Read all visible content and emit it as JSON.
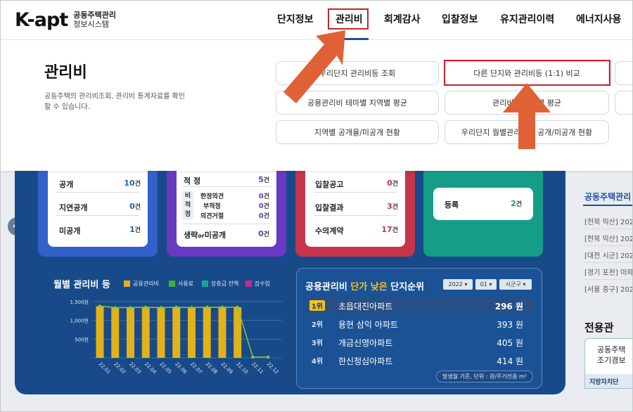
{
  "brand": {
    "logo": "K-apt",
    "sub_line1": "공동주택관리",
    "sub_line2": "정보시스템"
  },
  "nav": [
    "단지정보",
    "관리비",
    "회계감사",
    "입찰정보",
    "유지관리이력",
    "에너지사용"
  ],
  "mega": {
    "title": "관리비",
    "desc": "공동주택의 관리비조회, 관리비 통계자료를 확인 할 수 있습니다.",
    "menu": {
      "m1": "우리단지 관리비등 조회",
      "m2": "다른 단지와 관리비등 (1:1) 비교",
      "m3": "공용관리비 테마별 지역별 평균",
      "m4": "관리비등 지역별 평균",
      "m5": "지역별 공개율/미공개 현황",
      "m6": "우리단지 월별관리비등 공개/미공개 현황"
    }
  },
  "cards": {
    "c1": {
      "r1_label": "공개",
      "r1_val": "10",
      "r2_label": "지연공개",
      "r2_val": "0",
      "r3_label": "미공개",
      "r3_val": "1",
      "unit": "건"
    },
    "c2": {
      "top_label": "적 정",
      "top_val": "5",
      "side_label": "비적정",
      "s1_label": "한정의견",
      "s1_val": "0",
      "s2_label": "부적정",
      "s2_val": "0",
      "s3_label": "의견거절",
      "s3_val": "0",
      "bottom_label_a": "생략",
      "bottom_label_or": "or",
      "bottom_label_b": "미공개",
      "bottom_val": "0",
      "unit": "건"
    },
    "c3": {
      "r1_label": "입찰공고",
      "r1_val": "0",
      "r2_label": "입찰결과",
      "r2_val": "3",
      "r3_label": "수의계약",
      "r3_val": "17",
      "unit": "건"
    },
    "c4": {
      "label": "등록",
      "val": "2",
      "unit": "건"
    }
  },
  "chart_data": {
    "type": "bar",
    "title": "월별 관리비 등",
    "categories": [
      "22.01",
      "22.02",
      "22.03",
      "22.04",
      "22.05",
      "22.06",
      "22.07",
      "22.08",
      "22.09",
      "22.10",
      "22.11",
      "22.12"
    ],
    "series": [
      {
        "name": "공용관리비",
        "type": "bar",
        "values": [
          1380,
          1340,
          1340,
          1350,
          1340,
          1350,
          1340,
          1350,
          1350,
          1350,
          0,
          0
        ]
      },
      {
        "name": "사용료",
        "type": "line",
        "values": [
          1380,
          1340,
          1340,
          1350,
          1340,
          1350,
          1340,
          1350,
          1350,
          1350,
          20,
          20
        ]
      },
      {
        "name": "장충금 잔액",
        "values": []
      },
      {
        "name": "잡수입",
        "values": []
      }
    ],
    "yticks": [
      "1,500원",
      "1,000원",
      "500원"
    ],
    "ylim": [
      0,
      1500
    ],
    "colors": {
      "bar": "#e2b21a",
      "line": "#86c93a",
      "legend3": "#18a79a",
      "legend4": "#c42d91"
    }
  },
  "ranking": {
    "title_a": "공용관리비",
    "title_hl": "단가 낮은",
    "title_b": "단지순위",
    "sel_year": "2022",
    "sel_month": "01",
    "sel_region": "시군구",
    "rows": [
      {
        "rank": "1위",
        "name": "초읍대진아파트",
        "price": "296 원"
      },
      {
        "rank": "2위",
        "name": "용현 삼익 아파트",
        "price": "393 원"
      },
      {
        "rank": "3위",
        "name": "개금신영아파트",
        "price": "405 원"
      },
      {
        "rank": "4위",
        "name": "한신청심아파트",
        "price": "414 원"
      }
    ],
    "footnote": "발생월 기준, 단위 : 원/주거전용 m²"
  },
  "right": {
    "title": "공동주택관리",
    "news": [
      "[전북 익산] 2022",
      "[전북 익산] 2022",
      "[대전 시군] 2022",
      "[경기 포천] 아파",
      "[서울 중구] 2022"
    ],
    "jeonyong": "전용관",
    "box_line1": "공동주택",
    "box_line2": "조기경보",
    "box_footer": "지방자치단"
  },
  "icons": {
    "left_arrow": "arrow-left-icon"
  }
}
